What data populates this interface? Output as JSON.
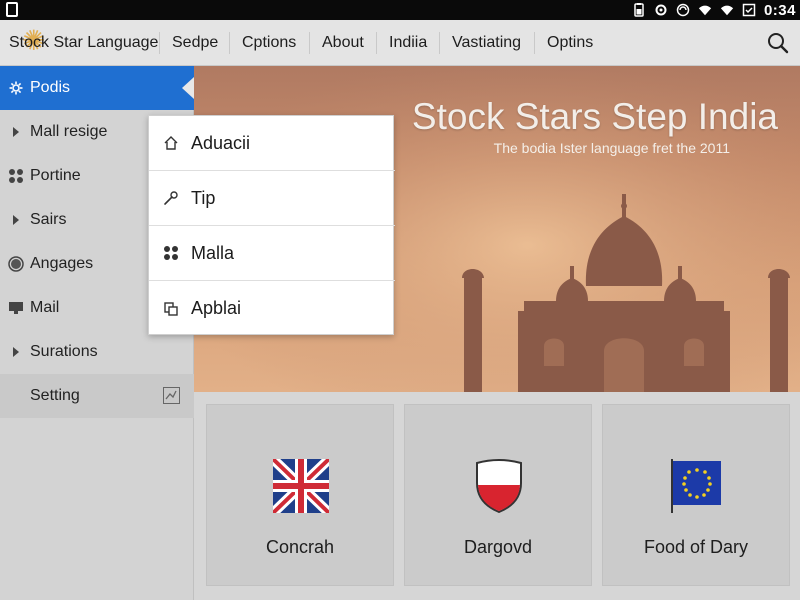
{
  "status_bar": {
    "time": "0:34",
    "icons": [
      "battery-icon",
      "settings-icon",
      "sync-icon",
      "wifi-icon",
      "signal-icon",
      "checkbox-icon"
    ]
  },
  "nav": {
    "brand": "Stock Star Language",
    "items": [
      "Sedpe",
      "Cptions",
      "About",
      "Indiia",
      "Vastiating",
      "Optins"
    ],
    "search_icon": "search-icon"
  },
  "sidebar": {
    "items": [
      {
        "label": "Podis",
        "icon": "gear-icon"
      },
      {
        "label": "Mall resige",
        "icon": "chevron-right-icon"
      },
      {
        "label": "Portine",
        "icon": "grid-icon"
      },
      {
        "label": "Sairs",
        "icon": "chevron-right-icon"
      },
      {
        "label": "Angages",
        "icon": "circle-icon"
      },
      {
        "label": "Mail",
        "icon": "monitor-icon"
      },
      {
        "label": "Surations",
        "icon": "chevron-right-icon"
      },
      {
        "label": "Setting",
        "icon": "chart-icon"
      }
    ]
  },
  "dropdown": {
    "items": [
      {
        "label": "Aduacii",
        "icon": "home-icon"
      },
      {
        "label": "Tip",
        "icon": "wrench-icon"
      },
      {
        "label": "Malla",
        "icon": "grid-icon"
      },
      {
        "label": "Apblai",
        "icon": "copy-icon"
      }
    ]
  },
  "hero": {
    "title": "Stock Stars Step India",
    "subtitle": "The bodia Ister language fret the 2011"
  },
  "cards": [
    {
      "label": "Concrah",
      "flag": "uk-flag-icon"
    },
    {
      "label": "Dargovd",
      "flag": "shield-flag-icon"
    },
    {
      "label": "Food of Dary",
      "flag": "eu-flag-icon"
    }
  ],
  "colors": {
    "accent": "#1f6fd1",
    "status_bar": "#0a0a0a",
    "hero_top": "#b07a62",
    "hero_bottom": "#e2b088"
  }
}
